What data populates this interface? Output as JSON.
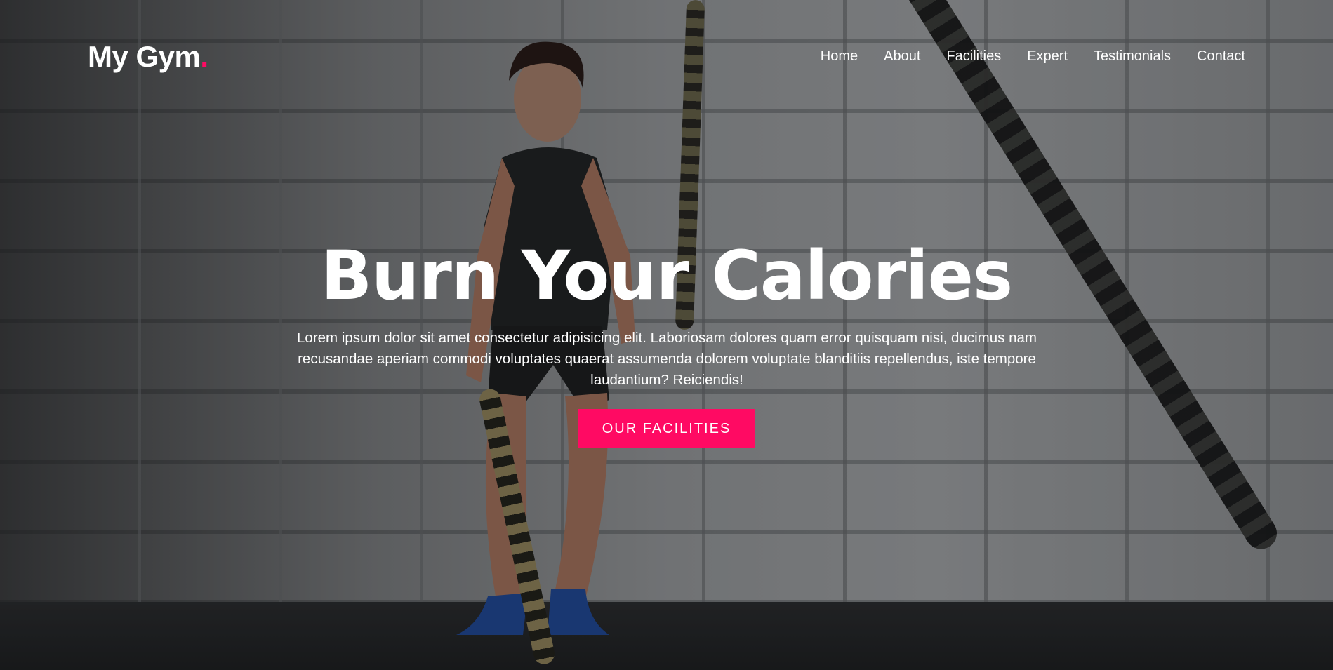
{
  "brand": {
    "name": "My Gym",
    "dot": ".",
    "accent_color": "#ff0a63"
  },
  "nav": {
    "items": [
      {
        "label": "Home"
      },
      {
        "label": "About"
      },
      {
        "label": "Facilities"
      },
      {
        "label": "Expert"
      },
      {
        "label": "Testimonials"
      },
      {
        "label": "Contact"
      }
    ]
  },
  "hero": {
    "title": "Burn Your Calories",
    "description": "Lorem ipsum dolor sit amet consectetur adipisicing elit. Laboriosam dolores quam error quisquam nisi, ducimus nam recusandae aperiam commodi voluptates quaerat assumenda dolorem voluptate blanditiis repellendus, iste tempore laudantium? Reiciendis!",
    "button_label": "OUR FACILITIES"
  },
  "colors": {
    "text": "#ffffff",
    "button": "#ff0a63"
  }
}
